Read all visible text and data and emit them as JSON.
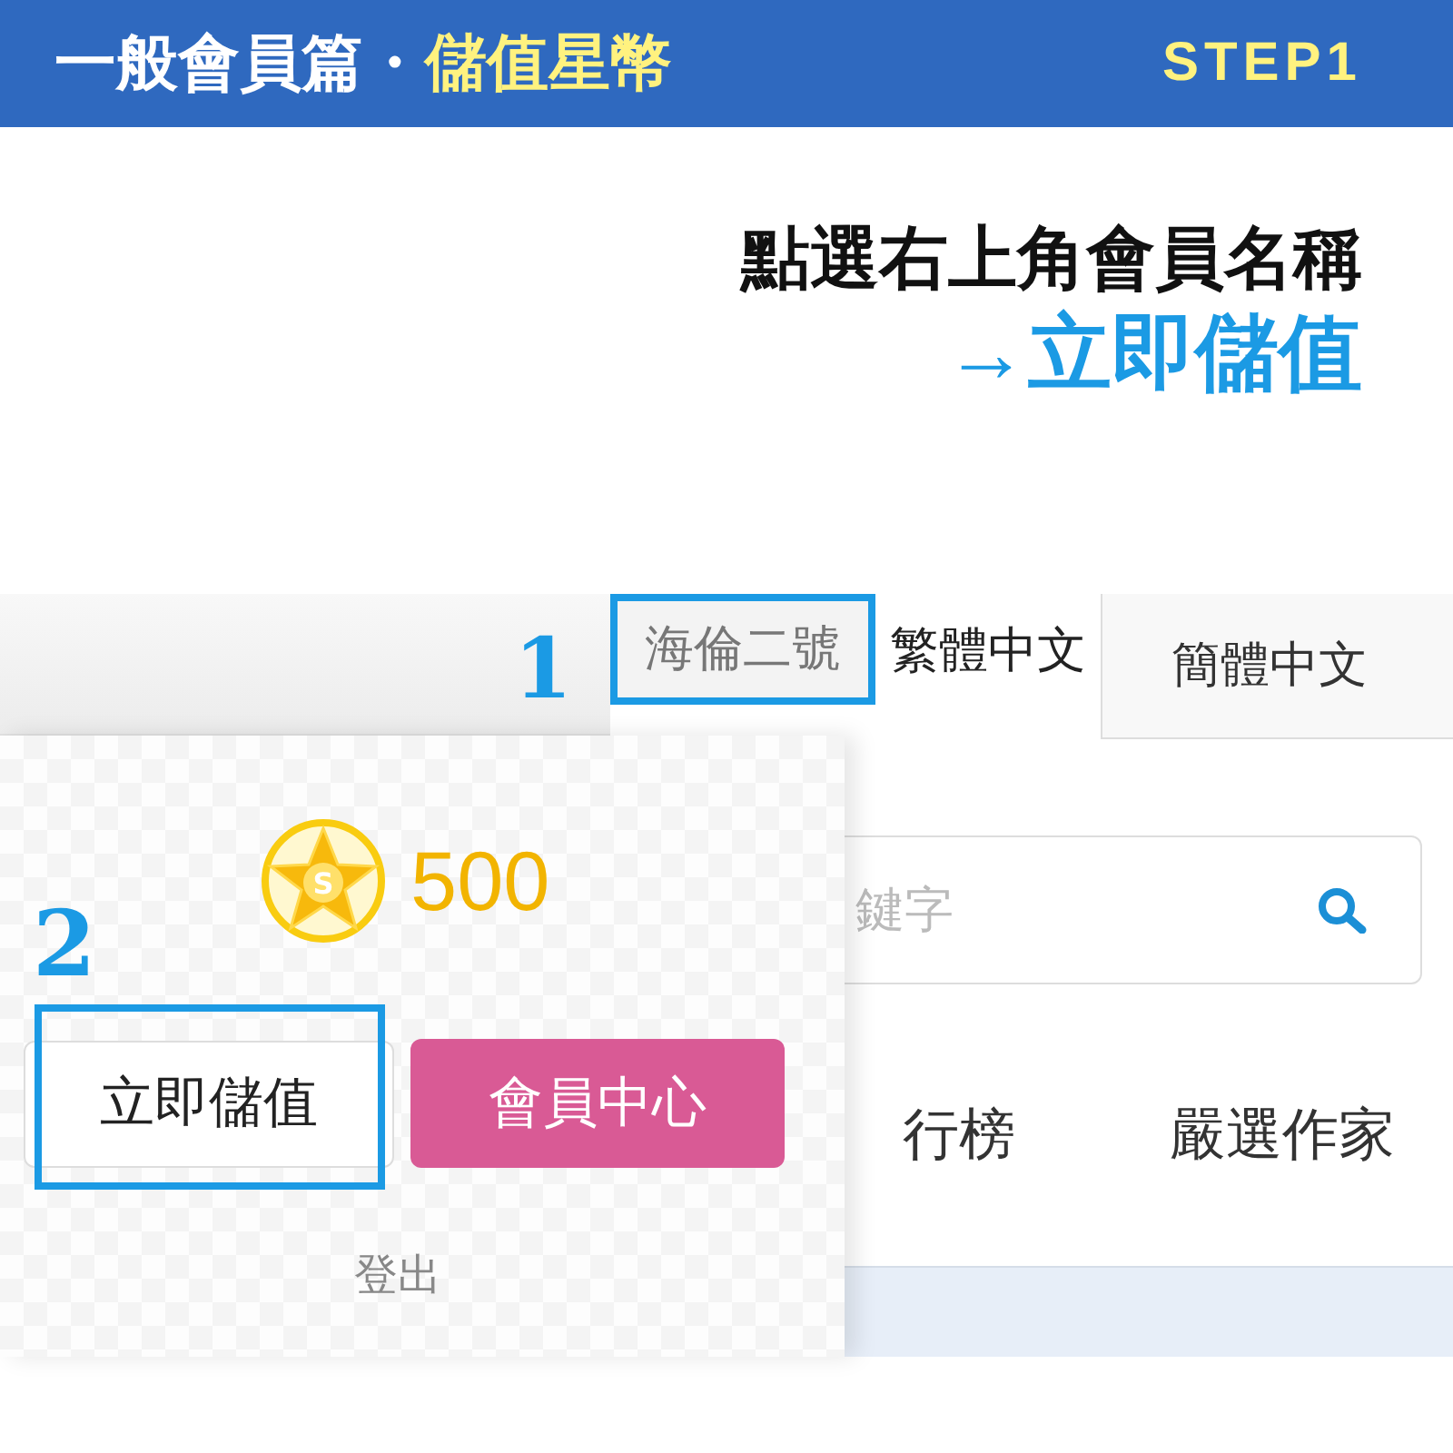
{
  "header": {
    "title": "一般會員篇・",
    "title_highlight": "儲值星幣",
    "step": "STEP1"
  },
  "instructions": [
    {
      "text": "點選右上角會員名稱",
      "kind": "plain"
    },
    {
      "text": "→立即儲值",
      "kind": "emphasis"
    }
  ],
  "screenshot": {
    "top_bar": {
      "marker": "1",
      "username": "海倫二號",
      "language_links": [
        {
          "label": "繁體中文",
          "selected": true
        },
        {
          "label": "簡體中文",
          "selected": false
        }
      ]
    },
    "member_menu": {
      "marker": "2",
      "coin": {
        "letter": "S",
        "balance": "500"
      },
      "buttons": [
        {
          "label": "立即儲值",
          "kind": "outline"
        },
        {
          "label": "會員中心",
          "kind": "filled"
        }
      ],
      "logout": "登出"
    },
    "search": {
      "placeholder": "鍵字"
    },
    "nav_items": [
      "行榜",
      "嚴選作家"
    ]
  }
}
